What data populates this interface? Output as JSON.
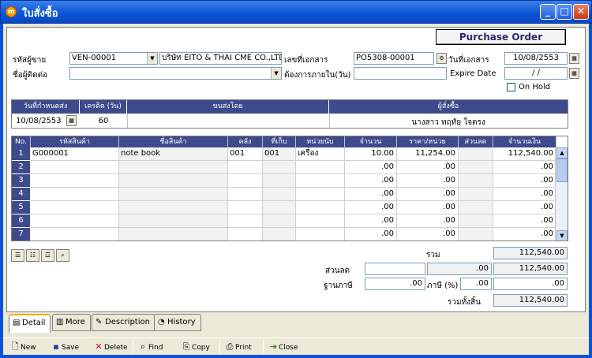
{
  "window": {
    "title": "ใบสั่งซื้อ",
    "icon_glyph": "m",
    "buttons": {
      "minimize": "_",
      "maximize": "□",
      "close": "✕"
    }
  },
  "po_button_label": "Purchase Order",
  "header": {
    "vendor_code_label": "รหัสผู้ขาย",
    "vendor_code": "VEN-00001",
    "vendor_name": "บริษัท EITO & THAI CME CO.,LTD",
    "doc_no_label": "เลขที่เอกสาร",
    "doc_no": "PO5308-00001",
    "doc_date_label": "วันที่เอกสาร",
    "doc_date": "10/08/2553",
    "contact_label": "ชื่อผู้ติดต่อ",
    "contact": "",
    "needed_within_label": "ต้องการภายใน(วัน)",
    "needed_within": "",
    "expire_label": "Expire Date",
    "expire_date": "/ /",
    "onhold_label": "On Hold"
  },
  "delivery": {
    "headers": [
      "วันที่กำหนดส่ง",
      "เครดิต (วัน)",
      "ขนส่งโดย",
      "ผู้สั่งซื้อ"
    ],
    "delivery_date": "10/08/2553",
    "credit_days": "60",
    "ship_by": "",
    "ordered_by": "นางสาว ทฤทัย ใจตรง"
  },
  "grid": {
    "headers": [
      "No.",
      "รหัสสินค้า",
      "ชื่อสินค้า",
      "คลัง",
      "ที่เก็บ",
      "หน่วยนับ",
      "จำนวน",
      "ราคา/หน่วย",
      "ส่วนลด",
      "จำนวนเงิน"
    ],
    "rows": [
      {
        "no": "1",
        "code": "G000001",
        "name": "note book",
        "wh": "001",
        "loc": "001",
        "unit": "เครื่อง",
        "qty": "10.00",
        "price": "11,254.00",
        "disc": "",
        "amount": "112,540.00"
      },
      {
        "no": "2",
        "code": "",
        "name": "",
        "wh": "",
        "loc": "",
        "unit": "",
        "qty": ".00",
        "price": ".00",
        "disc": "",
        "amount": ".00"
      },
      {
        "no": "3",
        "code": "",
        "name": "",
        "wh": "",
        "loc": "",
        "unit": "",
        "qty": ".00",
        "price": ".00",
        "disc": "",
        "amount": ".00"
      },
      {
        "no": "4",
        "code": "",
        "name": "",
        "wh": "",
        "loc": "",
        "unit": "",
        "qty": ".00",
        "price": ".00",
        "disc": "",
        "amount": ".00"
      },
      {
        "no": "5",
        "code": "",
        "name": "",
        "wh": "",
        "loc": "",
        "unit": "",
        "qty": ".00",
        "price": ".00",
        "disc": "",
        "amount": ".00"
      },
      {
        "no": "6",
        "code": "",
        "name": "",
        "wh": "",
        "loc": "",
        "unit": "",
        "qty": ".00",
        "price": ".00",
        "disc": "",
        "amount": ".00"
      },
      {
        "no": "7",
        "code": "",
        "name": "",
        "wh": "",
        "loc": "",
        "unit": "",
        "qty": ".00",
        "price": ".00",
        "disc": "",
        "amount": ".00"
      }
    ]
  },
  "totals": {
    "sum_label": "รวม",
    "sum": "112,540.00",
    "discount_label": "ส่วนลด",
    "discount_input": "",
    "discount_value": ".00",
    "after_discount": "112,540.00",
    "tax_base_label": "ฐานภาษี",
    "tax_base": ".00",
    "tax_label": "ภาษี (%)",
    "tax_percent": ".00",
    "tax_amount": ".00",
    "grand_total_label": "รวมทั้งสิ้น",
    "grand_total": "112,540.00"
  },
  "tabs": [
    "Detail",
    "More",
    "Description",
    "History"
  ],
  "toolbar": [
    "New",
    "Save",
    "Delete",
    "Find",
    "Copy",
    "Print",
    "Close"
  ]
}
